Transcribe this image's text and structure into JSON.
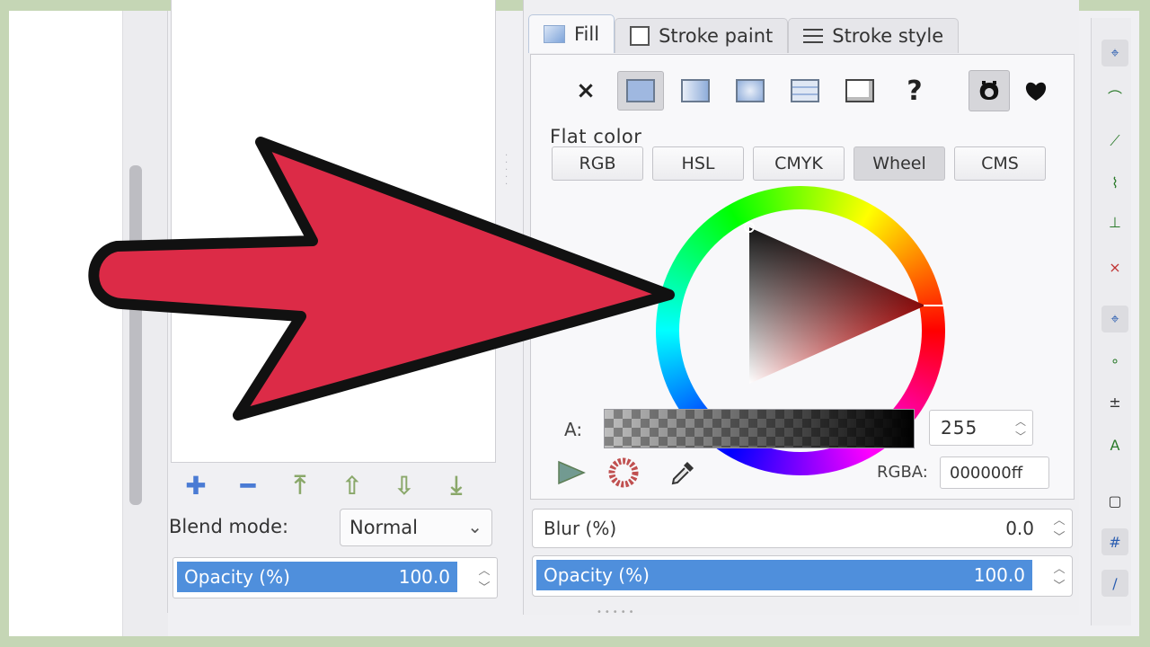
{
  "tabs": {
    "fill": "Fill",
    "stroke_paint": "Stroke paint",
    "stroke_style": "Stroke style"
  },
  "paint_types": {
    "none_icon": "×",
    "unset_icon": "?"
  },
  "flat_color": {
    "title": "Flat color",
    "modes": [
      "RGB",
      "HSL",
      "CMYK",
      "Wheel",
      "CMS"
    ],
    "active_mode": "Wheel"
  },
  "alpha": {
    "label": "A:",
    "value": "255"
  },
  "rgba": {
    "label": "RGBA:",
    "value": "000000ff"
  },
  "blur": {
    "label": "Blur (%)",
    "value": "0.0"
  },
  "opacity_right": {
    "label": "Opacity (%)",
    "value": "100.0"
  },
  "layers": {
    "blend_label": "Blend mode:",
    "blend_value": "Normal",
    "opacity_label": "Opacity (%)",
    "opacity_value": "100.0"
  },
  "colors": {
    "accent": "#4f8fdc",
    "arrow": "#dc2b47",
    "background": "#c5d6b5"
  }
}
